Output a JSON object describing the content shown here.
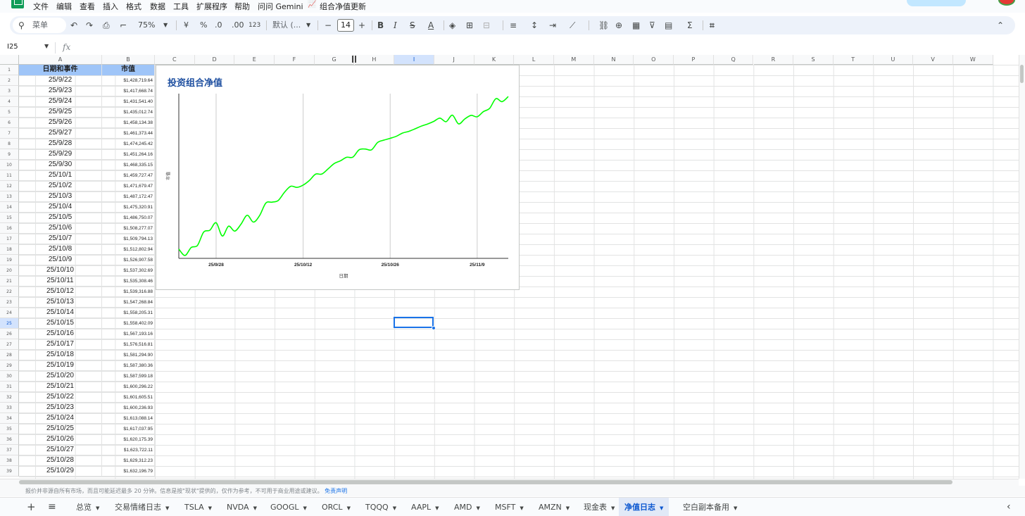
{
  "menubar": {
    "items": [
      "文件",
      "编辑",
      "查看",
      "插入",
      "格式",
      "数据",
      "工具",
      "扩展程序",
      "帮助",
      "问问 Gemini",
      "组合净值更新"
    ]
  },
  "toolbar": {
    "search_placeholder": "菜单",
    "zoom": "75%",
    "currency": "¥",
    "percent": "%",
    "decimal_decrease": ".0",
    "decimal_increase": ".00",
    "number_format": "123",
    "font_family": "默认 (...",
    "font_size": "14"
  },
  "formula_bar": {
    "cell_ref": "I25",
    "fx": "fx"
  },
  "columns": [
    "A",
    "B",
    "C",
    "D",
    "E",
    "F",
    "G",
    "H",
    "I",
    "J",
    "K",
    "L",
    "M",
    "N",
    "O",
    "P",
    "Q",
    "R",
    "S",
    "T",
    "U",
    "V",
    "W"
  ],
  "row_numbers": [
    "1",
    "2",
    "3",
    "4",
    "5",
    "6",
    "7",
    "8",
    "9",
    "10",
    "11",
    "12",
    "13",
    "14",
    "15",
    "16",
    "17",
    "18",
    "19",
    "20",
    "21",
    "22",
    "23",
    "24",
    "25",
    "26",
    "27",
    "28",
    "29",
    "30",
    "31",
    "32",
    "33",
    "34",
    "35",
    "36",
    "37",
    "38",
    "39"
  ],
  "table": {
    "headers": [
      "日期和事件",
      "市值"
    ],
    "rows": [
      [
        "25/9/22",
        "$1,428,719.64"
      ],
      [
        "25/9/23",
        "$1,417,668.74"
      ],
      [
        "25/9/24",
        "$1,431,541.40"
      ],
      [
        "25/9/25",
        "$1,435,012.74"
      ],
      [
        "25/9/26",
        "$1,458,134.38"
      ],
      [
        "25/9/27",
        "$1,461,373.44"
      ],
      [
        "25/9/28",
        "$1,474,245.42"
      ],
      [
        "25/9/29",
        "$1,451,264.16"
      ],
      [
        "25/9/30",
        "$1,468,335.15"
      ],
      [
        "25/10/1",
        "$1,459,727.47"
      ],
      [
        "25/10/2",
        "$1,471,679.47"
      ],
      [
        "25/10/3",
        "$1,487,172.47"
      ],
      [
        "25/10/4",
        "$1,475,320.91"
      ],
      [
        "25/10/5",
        "$1,486,750.07"
      ],
      [
        "25/10/6",
        "$1,508,277.07"
      ],
      [
        "25/10/7",
        "$1,509,794.13"
      ],
      [
        "25/10/8",
        "$1,512,802.94"
      ],
      [
        "25/10/9",
        "$1,526,907.58"
      ],
      [
        "25/10/10",
        "$1,537,302.69"
      ],
      [
        "25/10/11",
        "$1,535,308.46"
      ],
      [
        "25/10/12",
        "$1,539,316.88"
      ],
      [
        "25/10/13",
        "$1,547,268.84"
      ],
      [
        "25/10/14",
        "$1,558,205.31"
      ],
      [
        "25/10/15",
        "$1,558,402.09"
      ],
      [
        "25/10/16",
        "$1,567,193.16"
      ],
      [
        "25/10/17",
        "$1,576,516.81"
      ],
      [
        "25/10/18",
        "$1,581,294.90"
      ],
      [
        "25/10/19",
        "$1,587,380.36"
      ],
      [
        "25/10/20",
        "$1,587,599.18"
      ],
      [
        "25/10/21",
        "$1,600,296.22"
      ],
      [
        "25/10/22",
        "$1,601,605.51"
      ],
      [
        "25/10/23",
        "$1,600,236.93"
      ],
      [
        "25/10/24",
        "$1,613,088.14"
      ],
      [
        "25/10/25",
        "$1,617,037.95"
      ],
      [
        "25/10/26",
        "$1,620,175.39"
      ],
      [
        "25/10/27",
        "$1,623,722.11"
      ],
      [
        "25/10/28",
        "$1,629,312.23"
      ],
      [
        "25/10/29",
        "$1,632,196.79"
      ]
    ]
  },
  "chart_data": {
    "type": "line",
    "title": "投资组合净值",
    "xlabel": "日期",
    "ylabel": "市值",
    "x_ticks": [
      "25/9/28",
      "25/10/12",
      "25/10/26",
      "25/11/9"
    ],
    "x_start": "25/9/22",
    "x_end": "25/11/14",
    "grid": "vertical",
    "series_color": "#00ff00",
    "series": [
      {
        "values": [
          1428719.64,
          1417668.74,
          1431541.4,
          1435012.74,
          1458134.38,
          1461373.44,
          1474245.42,
          1451264.16,
          1468335.15,
          1459727.47,
          1471679.47,
          1487172.47,
          1475320.91,
          1486750.07,
          1508277.07,
          1509794.13,
          1512802.94,
          1526907.58,
          1537302.69,
          1535308.46,
          1539316.88,
          1547268.84,
          1558205.31,
          1558402.09,
          1567193.16,
          1576516.81,
          1581294.9,
          1587380.36,
          1587599.18,
          1600296.22,
          1601605.51,
          1600236.93,
          1613088.14,
          1617037.95,
          1620175.39,
          1623722.11,
          1629312.23,
          1632196.79,
          1636500,
          1641200,
          1644800,
          1649300,
          1655100,
          1648900,
          1660200,
          1645100,
          1653600,
          1659800,
          1657400,
          1666300,
          1671900,
          1688700,
          1683500,
          1692400
        ]
      }
    ]
  },
  "footer": {
    "disclaimer": "报价并非源自所有市场，而且可能延迟最多 20 分钟。信息是按\"现状\"提供的，仅作为参考，不可用于商业用途或建议。",
    "disclaimer_link": "免责声明"
  },
  "sheet_tabs": {
    "tabs": [
      "总览",
      "交易情绪日志",
      "TSLA",
      "NVDA",
      "GOOGL",
      "ORCL",
      "TQQQ",
      "AAPL",
      "AMD",
      "MSFT",
      "AMZN",
      "现金表",
      "净值日志",
      "空白副本备用"
    ],
    "active": "净值日志"
  }
}
